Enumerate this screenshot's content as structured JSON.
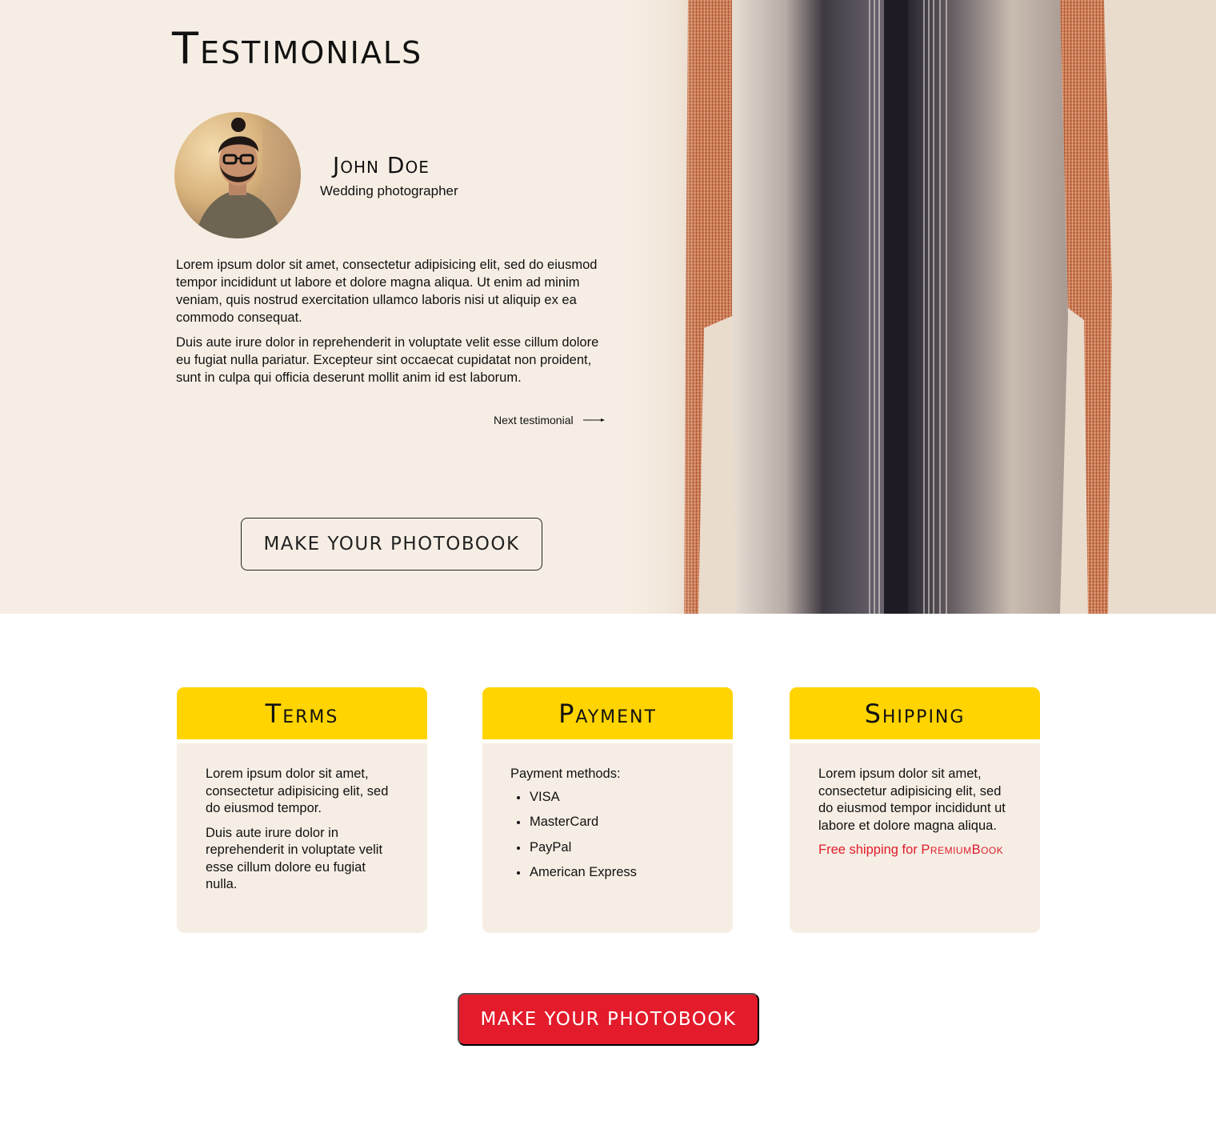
{
  "testimonials": {
    "title": "Testimonials",
    "person": {
      "name": "John Doe",
      "role": "Wedding photographer"
    },
    "quote": [
      "Lorem ipsum dolor sit amet, consectetur adipisicing elit, sed do eiusmod tempor incididunt ut labore et dolore magna aliqua. Ut enim ad minim veniam, quis nostrud exercitation ullamco laboris nisi ut aliquip ex ea commodo consequat.",
      "Duis aute irure dolor in reprehenderit in voluptate velit esse cillum dolore eu fugiat nulla pariatur. Excepteur sint occaecat cupidatat non proident, sunt in culpa qui officia deserunt mollit anim id est laborum."
    ],
    "next_label": "Next testimonial",
    "cta_label": "MAKE YOUR PHOTOBOOK"
  },
  "cards": {
    "terms": {
      "title": "Terms",
      "paragraphs": [
        "Lorem ipsum dolor sit amet, consectetur adipisicing elit, sed do eiusmod tempor.",
        "Duis aute irure dolor in reprehenderit in voluptate velit esse cillum dolore eu fugiat nulla."
      ]
    },
    "payment": {
      "title": "Payment",
      "intro": "Payment methods:",
      "methods": [
        "VISA",
        "MasterCard",
        "PayPal",
        "American Express"
      ]
    },
    "shipping": {
      "title": "Shipping",
      "paragraph": "Lorem ipsum dolor sit amet, consectetur adipisicing elit, sed do eiusmod tempor incididunt ut labore et dolore magna aliqua.",
      "free_prefix": "Free shipping for ",
      "free_brand": "PremiumBook"
    }
  },
  "footer_cta_label": "MAKE YOUR PHOTOBOOK",
  "colors": {
    "hero_bg": "#f6eee4",
    "card_header": "#ffd400",
    "card_body": "#f6eee4",
    "cta_red": "#e31b2b",
    "highlight_red": "#e01b2c"
  },
  "icons": {
    "next": "arrow-right-icon"
  }
}
